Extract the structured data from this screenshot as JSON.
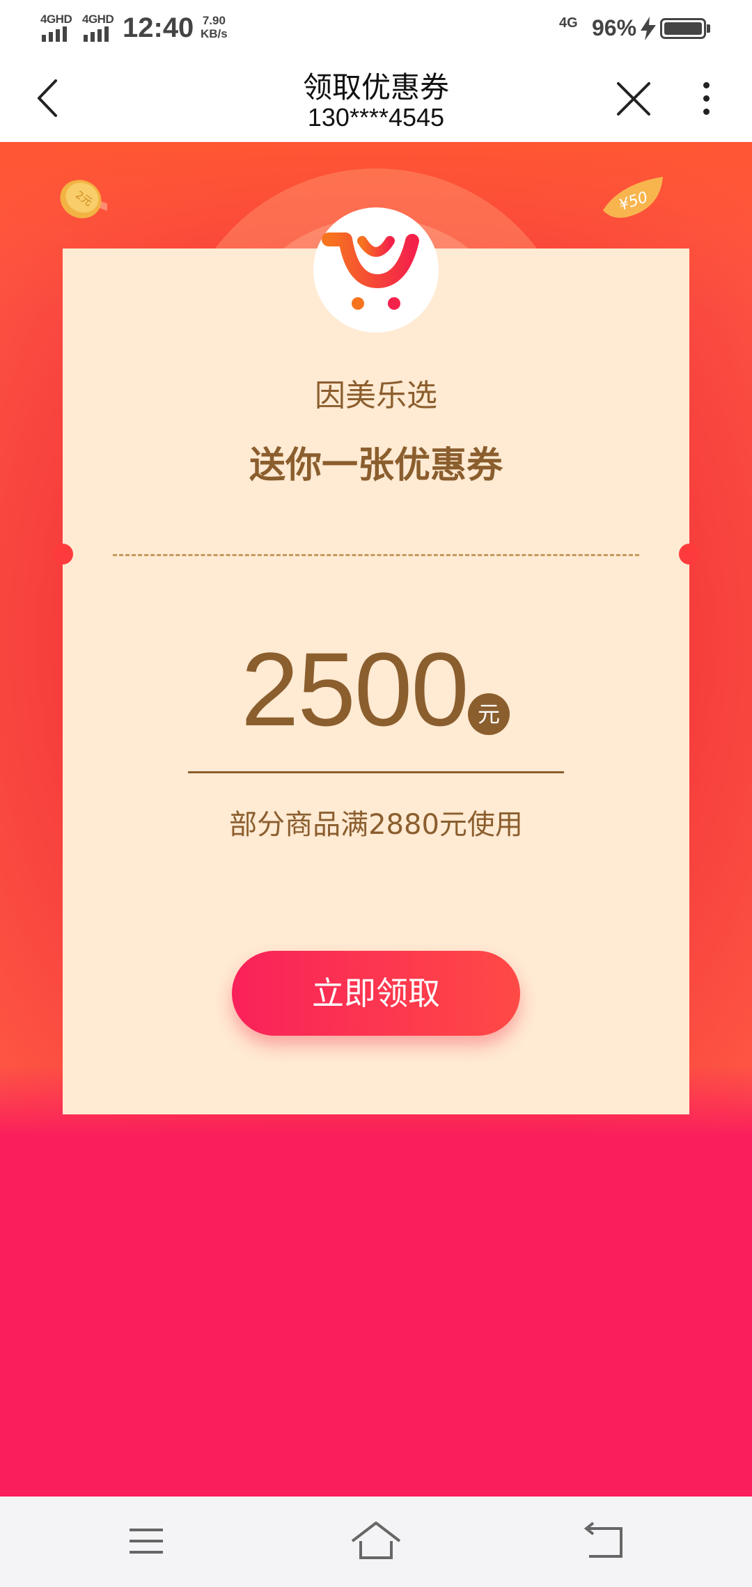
{
  "status_bar": {
    "network_1": "4GHD",
    "network_2": "4GHD",
    "time": "12:40",
    "speed_value": "7.90",
    "speed_unit": "KB/s",
    "data_network": "4G",
    "battery_percent": "96%"
  },
  "title_bar": {
    "title": "领取优惠券",
    "subtitle": "130****4545"
  },
  "coupon": {
    "brand_name": "因美乐选",
    "headline": "送你一张优惠券",
    "amount": "2500",
    "currency": "元",
    "condition": "部分商品满2880元使用",
    "claim_button": "立即领取"
  },
  "decorations": {
    "coin_text": "2元",
    "leaf_text": "¥50"
  },
  "colors": {
    "brand_red": "#f53b3b",
    "button_pink": "#f9215a",
    "coupon_bg": "#ffead3",
    "coupon_text": "#8b5e2e",
    "bottom_pink": "#fa1e5c"
  }
}
